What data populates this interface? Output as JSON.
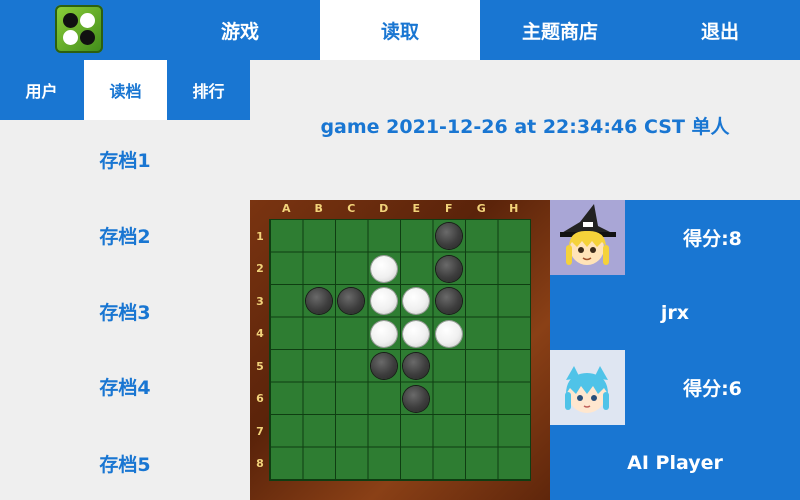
{
  "nav": {
    "tabs": [
      {
        "label": "游戏"
      },
      {
        "label": "读取"
      },
      {
        "label": "主题商店"
      },
      {
        "label": "退出"
      }
    ],
    "active_tab": "读取"
  },
  "subnav": {
    "tabs": [
      {
        "label": "用户"
      },
      {
        "label": "读档"
      },
      {
        "label": "排行"
      }
    ],
    "active_tab": "读档"
  },
  "saves": [
    {
      "label": "存档1"
    },
    {
      "label": "存档2"
    },
    {
      "label": "存档3"
    },
    {
      "label": "存档4"
    },
    {
      "label": "存档5"
    }
  ],
  "game": {
    "title": "game 2021-12-26 at 22:34:46 CST 单人",
    "columns": [
      "A",
      "B",
      "C",
      "D",
      "E",
      "F",
      "G",
      "H"
    ],
    "rows": [
      "1",
      "2",
      "3",
      "4",
      "5",
      "6",
      "7",
      "8"
    ],
    "stones": [
      {
        "cell": "F1",
        "color": "black"
      },
      {
        "cell": "D2",
        "color": "white"
      },
      {
        "cell": "F2",
        "color": "black"
      },
      {
        "cell": "B3",
        "color": "black"
      },
      {
        "cell": "C3",
        "color": "black"
      },
      {
        "cell": "D3",
        "color": "white"
      },
      {
        "cell": "E3",
        "color": "white"
      },
      {
        "cell": "F3",
        "color": "black"
      },
      {
        "cell": "D4",
        "color": "white"
      },
      {
        "cell": "E4",
        "color": "white"
      },
      {
        "cell": "F4",
        "color": "white"
      },
      {
        "cell": "D5",
        "color": "black"
      },
      {
        "cell": "E5",
        "color": "black"
      },
      {
        "cell": "E6",
        "color": "black"
      }
    ]
  },
  "players": [
    {
      "name": "jrx",
      "score": "得分:8",
      "avatar": "witch-character-icon"
    },
    {
      "name": "AI Player",
      "score": "得分:6",
      "avatar": "blue-hair-character-icon"
    }
  ],
  "colors": {
    "primary": "#1976d2",
    "board_green": "#2e7d32",
    "frame_brown": "#6b2a0c",
    "label_gold": "#f2d37a"
  }
}
